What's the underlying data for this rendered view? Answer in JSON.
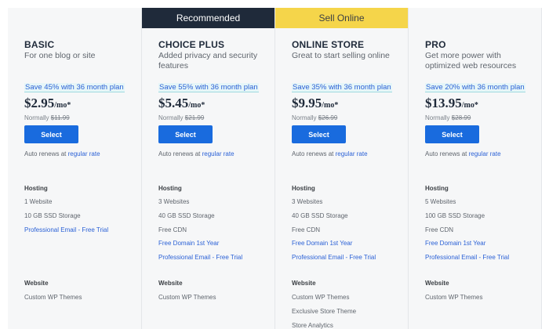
{
  "plans": [
    {
      "banner": "",
      "name": "BASIC",
      "desc": "For one blog or site",
      "save": "Save 45% with 36 month plan",
      "price": "$2.95",
      "per": "/mo*",
      "normally_label": "Normally",
      "normally_price": "$11.99",
      "button": "Select",
      "auto_text": "Auto renews at",
      "auto_link": "regular rate",
      "hosting_title": "Hosting",
      "hosting": [
        {
          "text": "1 Website",
          "link": false
        },
        {
          "text": "10 GB SSD Storage",
          "link": false
        },
        {
          "text": "Professional Email - Free Trial",
          "link": true
        }
      ],
      "website_title": "Website",
      "website": [
        {
          "text": "Custom WP Themes",
          "link": false
        }
      ]
    },
    {
      "banner": "Recommended",
      "name": "CHOICE PLUS",
      "desc": "Added privacy and security features",
      "save": "Save 55% with 36 month plan",
      "price": "$5.45",
      "per": "/mo*",
      "normally_label": "Normally",
      "normally_price": "$21.99",
      "button": "Select",
      "auto_text": "Auto renews at",
      "auto_link": "regular rate",
      "hosting_title": "Hosting",
      "hosting": [
        {
          "text": "3 Websites",
          "link": false
        },
        {
          "text": "40 GB SSD Storage",
          "link": false
        },
        {
          "text": "Free CDN",
          "link": false
        },
        {
          "text": "Free Domain 1st Year",
          "link": true
        },
        {
          "text": "Professional Email - Free Trial",
          "link": true
        }
      ],
      "website_title": "Website",
      "website": [
        {
          "text": "Custom WP Themes",
          "link": false
        }
      ]
    },
    {
      "banner": "Sell Online",
      "name": "ONLINE STORE",
      "desc": "Great to start selling online",
      "save": "Save 35% with 36 month plan",
      "price": "$9.95",
      "per": "/mo*",
      "normally_label": "Normally",
      "normally_price": "$26.99",
      "button": "Select",
      "auto_text": "Auto renews at",
      "auto_link": "regular rate",
      "hosting_title": "Hosting",
      "hosting": [
        {
          "text": "3 Websites",
          "link": false
        },
        {
          "text": "40 GB SSD Storage",
          "link": false
        },
        {
          "text": "Free CDN",
          "link": false
        },
        {
          "text": "Free Domain 1st Year",
          "link": true
        },
        {
          "text": "Professional Email - Free Trial",
          "link": true
        }
      ],
      "website_title": "Website",
      "website": [
        {
          "text": "Custom WP Themes",
          "link": false
        },
        {
          "text": "Exclusive Store Theme",
          "link": false
        },
        {
          "text": "Store Analytics",
          "link": false
        }
      ]
    },
    {
      "banner": "",
      "name": "PRO",
      "desc": "Get more power with optimized web resources",
      "save": "Save 20% with 36 month plan",
      "price": "$13.95",
      "per": "/mo*",
      "normally_label": "Normally",
      "normally_price": "$28.99",
      "button": "Select",
      "auto_text": "Auto renews at",
      "auto_link": "regular rate",
      "hosting_title": "Hosting",
      "hosting": [
        {
          "text": "5 Websites",
          "link": false
        },
        {
          "text": "100 GB SSD Storage",
          "link": false
        },
        {
          "text": "Free CDN",
          "link": false
        },
        {
          "text": "Free Domain 1st Year",
          "link": true
        },
        {
          "text": "Professional Email - Free Trial",
          "link": true
        }
      ],
      "website_title": "Website",
      "website": [
        {
          "text": "Custom WP Themes",
          "link": false
        }
      ]
    }
  ],
  "colors": {
    "primary_button": "#196bde",
    "link": "#2b61d6",
    "recommended_banner": "#1f2a3a",
    "sell_online_banner": "#f5d54a",
    "save_highlight": "#e6f6f8"
  }
}
